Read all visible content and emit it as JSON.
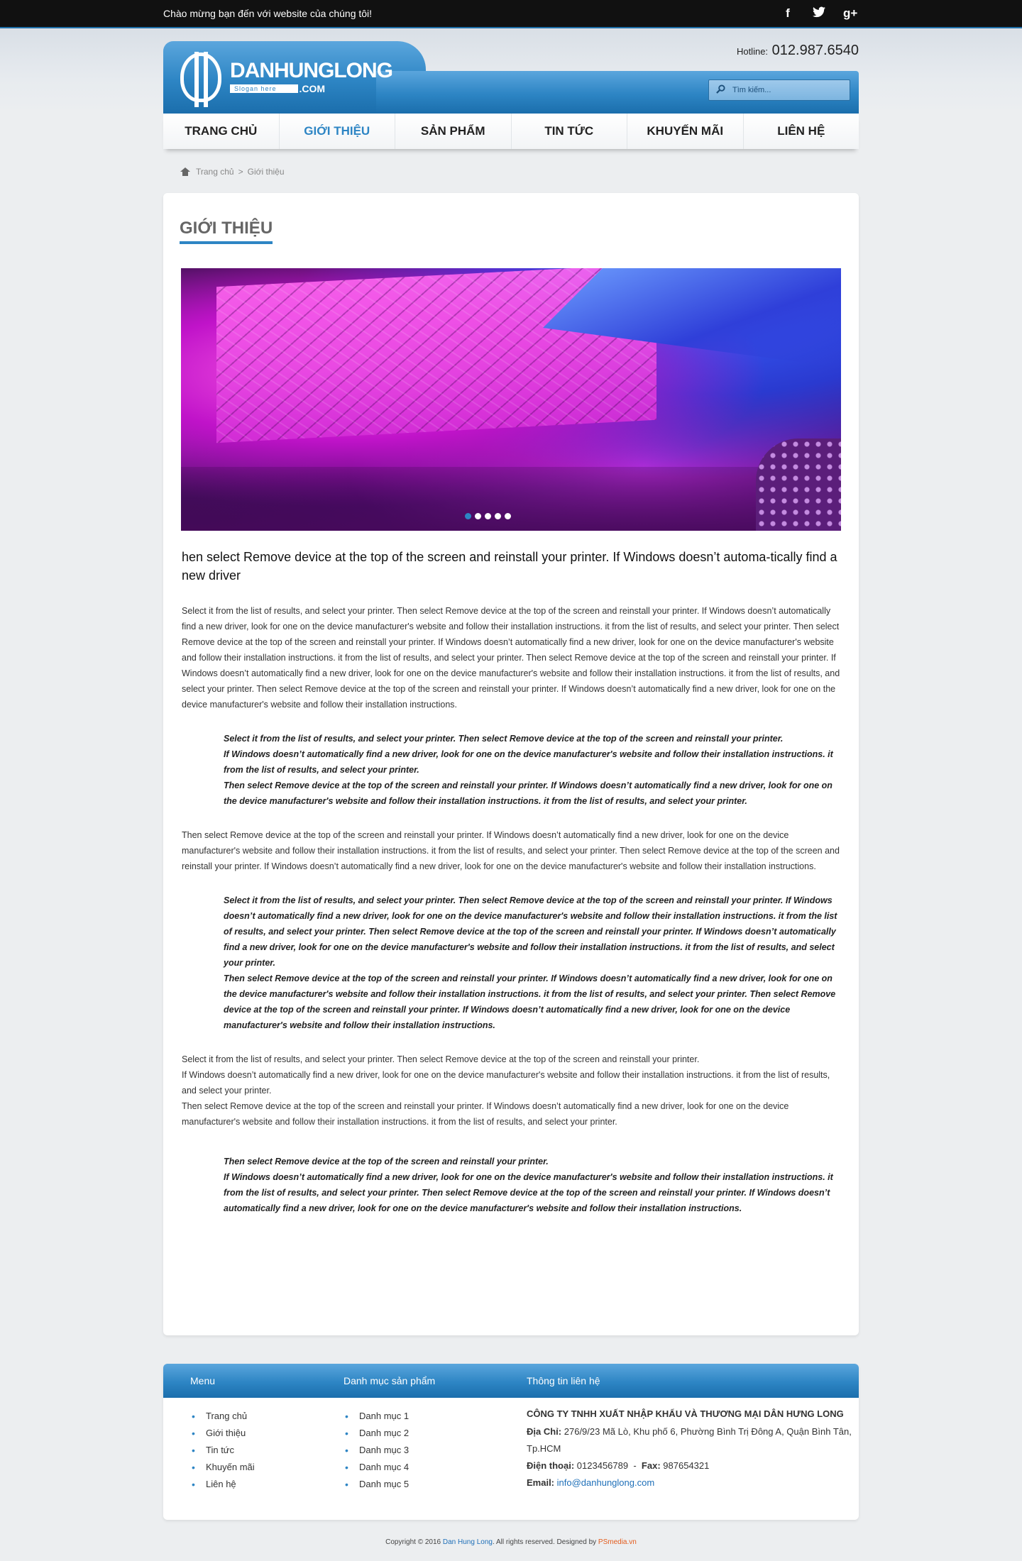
{
  "topbar": {
    "welcome": "Chào mừng bạn đến với website của chúng tôi!",
    "social_icons": [
      "facebook-icon",
      "twitter-icon",
      "google-plus-icon"
    ]
  },
  "header": {
    "logo_name": "DANHUNGLONG",
    "logo_slogan": "Slogan here",
    "logo_domain": ".COM",
    "hotline_label": "Hotline:",
    "hotline_number": "012.987.6540",
    "search_placeholder": "Tìm kiếm..."
  },
  "nav": {
    "items": [
      "TRANG CHỦ",
      "GIỚI THIỆU",
      "SẢN PHẨM",
      "TIN TỨC",
      "KHUYẾN MÃI",
      "LIÊN HỆ"
    ],
    "active_index": 1
  },
  "breadcrumb": {
    "home": "Trang chủ",
    "separator": ">",
    "current": "Giới thiệu"
  },
  "main": {
    "title": "GIỚI THIỆU",
    "slider_dots": 5,
    "slider_active": 0,
    "lead": "hen select Remove device at the top of the screen and reinstall your printer. If Windows doesn’t automa-tically find a new driver",
    "para1": "Select it from the list of results, and select your printer. Then select Remove device at the top of the screen and reinstall your printer. If Windows doesn’t automatically find a new driver, look for one on the device manufacturer's website and follow their installation instructions.  it from the list of results, and select your printer. Then select Remove device at the top of the screen and reinstall your printer. If Windows doesn’t automatically find a new driver, look for one on the device manufacturer's website and follow their installation instructions.  it from the list of results, and select your printer. Then select Remove device at the top of the screen and reinstall your printer. If Windows doesn’t automatically find a new driver, look for one on the device manufacturer's website and follow their installation instructions.  it from the list of results, and select your printer. Then select Remove device at the top of the screen and reinstall your printer. If Windows doesn’t automatically find a new driver, look for one on the device manufacturer's website and follow their installation instructions.",
    "quote1": [
      "Select it from the list of results, and select your printer. Then select Remove device at the top of the screen and reinstall your printer.",
      "If Windows doesn’t automatically find a new driver, look for one on the device manufacturer's website and follow their installation instructions.  it from the list of results, and select your printer.",
      "Then select Remove device at the top of the screen and reinstall your printer. If Windows doesn’t automatically find a new driver, look for one on the device manufacturer's website and follow their installation instructions.  it from the list of results, and select your printer."
    ],
    "para2": "Then select Remove device at the top of the screen and reinstall your printer. If Windows doesn’t automatically find a new driver, look for one on the device manufacturer's website and follow their installation instructions.  it from the list of results, and select your printer. Then select Remove device at the top of the screen and reinstall your printer. If Windows doesn’t automatically find a new driver, look for one on the device manufacturer's website and follow their installation instructions.",
    "quote2": [
      "Select it from the list of results, and select your printer. Then select Remove device at the top of the screen and reinstall your printer. If Windows doesn’t automatically find a new driver, look for one on the device manufacturer's website and follow their installation instructions.  it from the list of results, and select your printer. Then select Remove device at the top of the screen and reinstall your printer. If Windows doesn’t automatically find a new driver, look for one on the device manufacturer's website and follow their installation instructions.  it from the list of results, and select your printer.",
      "Then select Remove device at the top of the screen and reinstall your printer. If Windows doesn’t automatically find a new driver, look for one on the device manufacturer's website and follow their installation instructions.  it from the list of results, and select your printer. Then select Remove device at the top of the screen and reinstall your printer. If Windows doesn’t automatically find a new driver, look for one on the device manufacturer's website and follow their installation instructions."
    ],
    "para3": [
      "Select it from the list of results, and select your printer. Then select Remove device at the top of the screen and reinstall your printer.",
      "If Windows doesn’t automatically find a new driver, look for one on the device manufacturer's website and follow their installation instructions.  it from the list of results, and select your printer.",
      "Then select Remove device at the top of the screen and reinstall your printer. If Windows doesn’t automatically find a new driver, look for one on the device manufacturer's website and follow their installation instructions.  it from the list of results, and select your printer."
    ],
    "quote3": [
      "Then select Remove device at the top of the screen and reinstall your printer.",
      "If Windows doesn’t automatically find a new driver, look for one on the device manufacturer's website and follow their installation instructions.  it from the list of results, and select your printer. Then select Remove device at the top of the screen and reinstall your printer. If Windows doesn’t automatically find a new driver, look for one on the device manufacturer's website and follow their installation instructions."
    ]
  },
  "footer": {
    "headings": {
      "menu": "Menu",
      "categories": "Danh mục sản phẩm",
      "contact": "Thông tin liên hệ"
    },
    "menu_items": [
      "Trang chủ",
      "Giới thiệu",
      "Tin tức",
      "Khuyến mãi",
      "Liên hệ"
    ],
    "category_items": [
      "Danh mục 1",
      "Danh mục 2",
      "Danh mục 3",
      "Danh mục 4",
      "Danh mục 5"
    ],
    "company": "CÔNG TY TNHH XUẤT NHẬP KHẨU VÀ THƯƠNG MẠI DÂN HƯNG LONG",
    "address_label": "Địa Chỉ:",
    "address": "276/9/23 Mã Lò, Khu phố 6, Phường Bình Trị Đông A, Quận Bình Tân, Tp.HCM",
    "phone_label": "Điện thoại:",
    "phone": "0123456789",
    "phone_sep": "-",
    "fax_label": "Fax:",
    "fax": "987654321",
    "email_label": "Email:",
    "email": "info@danhunglong.com"
  },
  "copyright": {
    "prefix": "Copyright © 2016",
    "brand": "Dan Hung Long",
    "middle": ". All rights reserved. Designed by",
    "designer": "PSmedia.vn"
  },
  "colors": {
    "accent": "#2d85c4",
    "topbar": "#111111",
    "page_bg": "#eceef0"
  }
}
